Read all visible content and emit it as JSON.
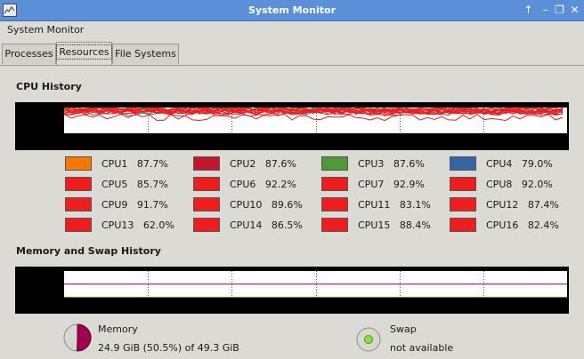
{
  "window": {
    "title": "System Monitor",
    "buttons": [
      "↑",
      "–",
      "❐",
      "✕"
    ]
  },
  "menubar": {
    "label": "System Monitor"
  },
  "tabs": [
    {
      "label": "Processes",
      "active": false
    },
    {
      "label": "Resources",
      "active": true
    },
    {
      "label": "File Systems",
      "active": false
    }
  ],
  "cpu": {
    "title": "CPU History",
    "items": [
      {
        "name": "CPU1",
        "percent": "87.7%",
        "color": "#f57900"
      },
      {
        "name": "CPU2",
        "percent": "87.6%",
        "color": "#c4162a"
      },
      {
        "name": "CPU3",
        "percent": "87.6%",
        "color": "#4e9a36"
      },
      {
        "name": "CPU4",
        "percent": "79.0%",
        "color": "#3465a4"
      },
      {
        "name": "CPU5",
        "percent": "85.7%",
        "color": "#ef1e1e"
      },
      {
        "name": "CPU6",
        "percent": "92.2%",
        "color": "#ef1e1e"
      },
      {
        "name": "CPU7",
        "percent": "92.9%",
        "color": "#ef1e1e"
      },
      {
        "name": "CPU8",
        "percent": "92.0%",
        "color": "#ef1e1e"
      },
      {
        "name": "CPU9",
        "percent": "91.7%",
        "color": "#ef1e1e"
      },
      {
        "name": "CPU10",
        "percent": "89.6%",
        "color": "#ef1e1e"
      },
      {
        "name": "CPU11",
        "percent": "83.1%",
        "color": "#ef1e1e"
      },
      {
        "name": "CPU12",
        "percent": "87.4%",
        "color": "#ef1e1e"
      },
      {
        "name": "CPU13",
        "percent": "62.0%",
        "color": "#ef1e1e"
      },
      {
        "name": "CPU14",
        "percent": "86.5%",
        "color": "#ef1e1e"
      },
      {
        "name": "CPU15",
        "percent": "88.4%",
        "color": "#ef1e1e"
      },
      {
        "name": "CPU16",
        "percent": "82.4%",
        "color": "#ef1e1e"
      }
    ]
  },
  "memory": {
    "title": "Memory and Swap History",
    "memory_label": "Memory",
    "memory_value": "24.9 GiB (50.5%) of 49.3 GiB",
    "memory_fraction": 0.505,
    "memory_color": "#a40052",
    "swap_label": "Swap",
    "swap_value": "not available",
    "swap_color": "#4e9a06"
  }
}
